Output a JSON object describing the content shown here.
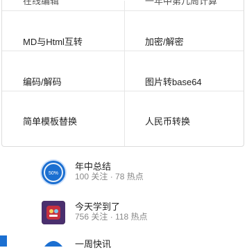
{
  "tools": {
    "cut_left": "在线编辑",
    "cut_right": "一年中第几周计算",
    "items": [
      {
        "label": "MD与Html互转"
      },
      {
        "label": "加密/解密"
      },
      {
        "label": "编码/解码"
      },
      {
        "label": "图片转base64"
      },
      {
        "label": "简单模板替换"
      },
      {
        "label": "人民币转换"
      }
    ]
  },
  "topics": [
    {
      "title": "年中总结",
      "follows": "100 关注",
      "sep": "·",
      "views": "78 热点",
      "badge": "50%"
    },
    {
      "title": "今天学到了",
      "follows": "756 关注",
      "sep": "·",
      "views": "118 热点"
    },
    {
      "title": "一周快讯"
    }
  ],
  "colors": {
    "accent": "#1b6fd1",
    "muted": "#888888"
  }
}
